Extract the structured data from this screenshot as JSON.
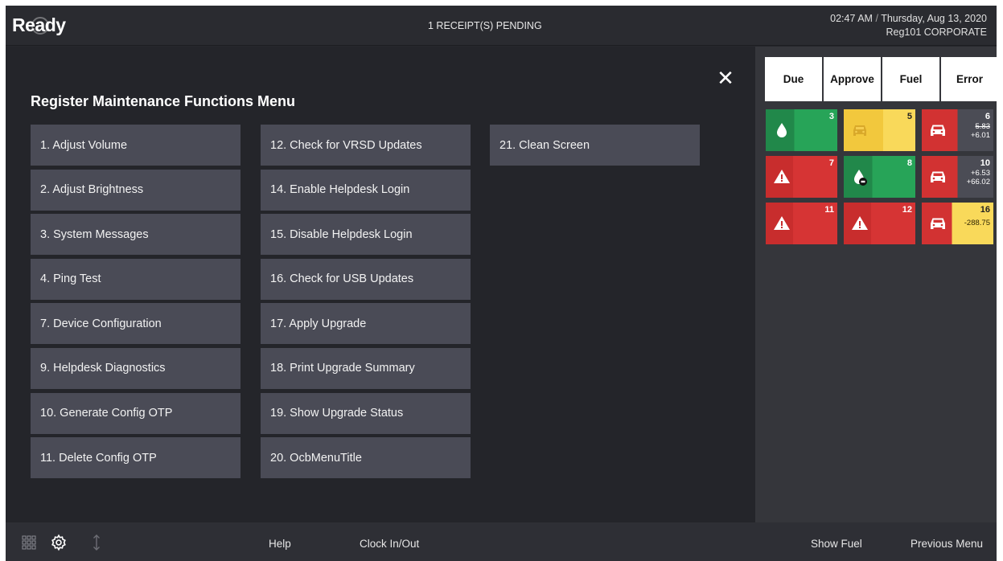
{
  "header": {
    "status": "Ready",
    "pending": "1 RECEIPT(S) PENDING",
    "time": "02:47 AM",
    "separator": "/",
    "date": "Thursday, Aug 13, 2020",
    "register": "Reg101 CORPORATE"
  },
  "menu": {
    "title": "Register Maintenance Functions Menu",
    "close_icon": "close-icon",
    "columns": [
      [
        "1. Adjust Volume",
        "2. Adjust Brightness",
        "3. System Messages",
        "4. Ping Test",
        "7. Device Configuration",
        "9. Helpdesk Diagnostics",
        "10. Generate Config OTP",
        "11. Delete Config OTP"
      ],
      [
        "12. Check for VRSD Updates",
        "14. Enable Helpdesk Login",
        "15. Disable Helpdesk Login",
        "16. Check for USB Updates",
        "17. Apply Upgrade",
        "18. Print Upgrade Summary",
        "19. Show Upgrade Status",
        "20. OcbMenuTitle"
      ],
      [
        "21. Clean Screen"
      ]
    ]
  },
  "fuel_panel": {
    "tabs": [
      "Due",
      "Approve",
      "Fuel",
      "Error"
    ],
    "pumps": [
      {
        "number": "3",
        "icon": "fuel-drop-icon",
        "color": "#27a458"
      },
      {
        "number": "5",
        "icon": "car-icon",
        "color": "#f9d95a"
      },
      {
        "number": "6",
        "icon": "car-icon",
        "amount_1": "5.83",
        "amount_2": "+6.01",
        "color": "#d23232"
      },
      {
        "number": "7",
        "icon": "warning-icon",
        "color": "#d63434"
      },
      {
        "number": "8",
        "icon": "fuel-drop-icon",
        "color": "#27a458"
      },
      {
        "number": "10",
        "icon": "car-icon",
        "amount_1": "+6.53",
        "amount_2": "+66.02",
        "color": "#d23232"
      },
      {
        "number": "11",
        "icon": "warning-icon",
        "color": "#d63434"
      },
      {
        "number": "12",
        "icon": "warning-icon",
        "color": "#d63434"
      },
      {
        "number": "16",
        "icon": "car-icon",
        "amount_1": "-288.75",
        "color": "#f9d95a"
      }
    ]
  },
  "footer": {
    "icons": [
      "grid-icon",
      "gear-icon",
      "arrows-icon"
    ],
    "help": "Help",
    "clock_in_out": "Clock In/Out",
    "show_fuel": "Show Fuel",
    "previous_menu": "Previous Menu"
  }
}
